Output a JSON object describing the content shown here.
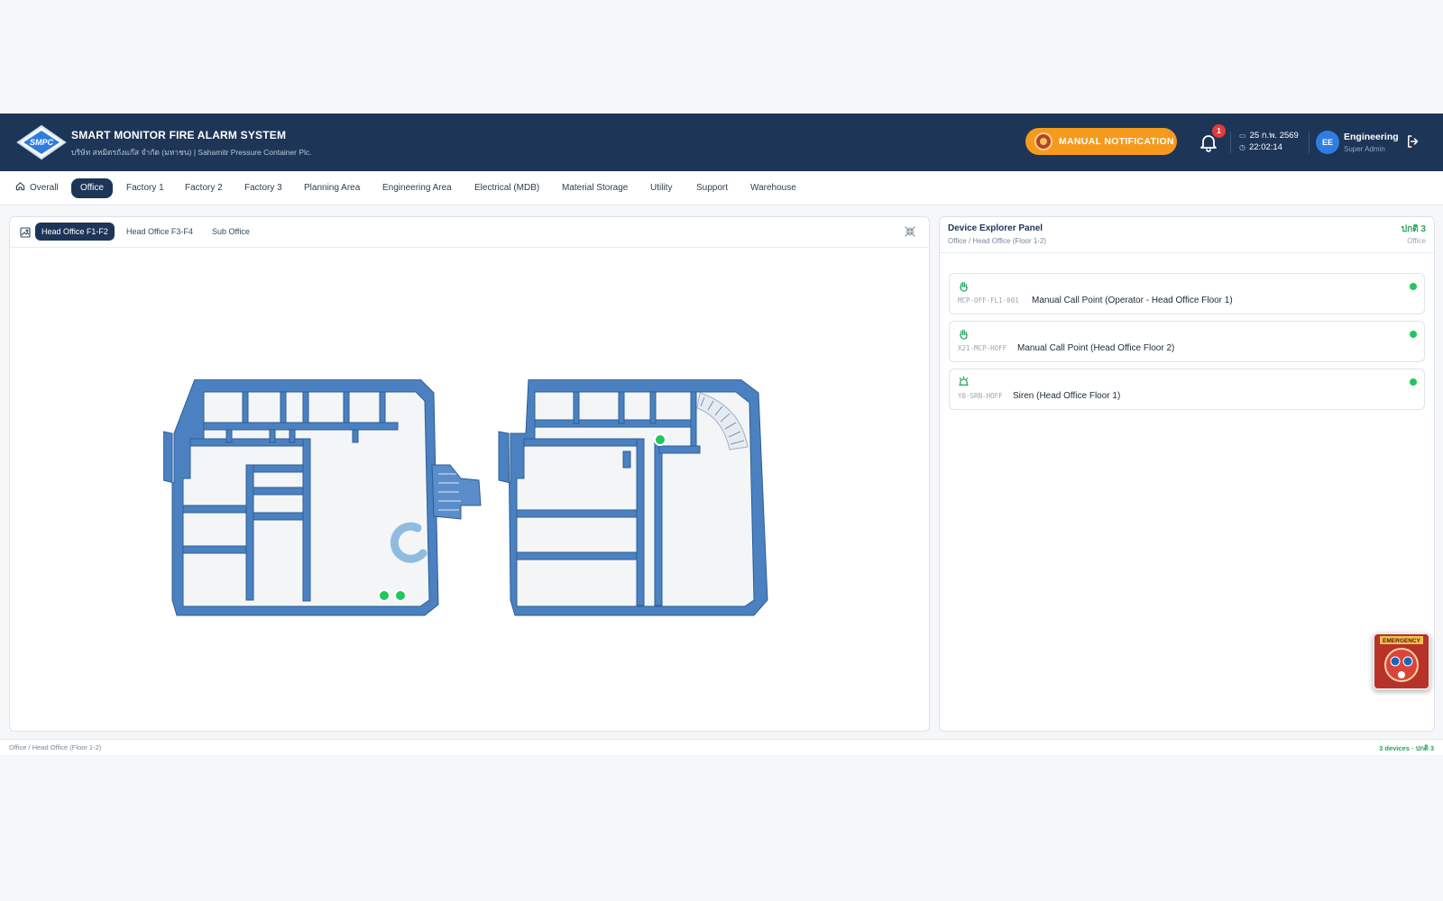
{
  "header": {
    "title": "SMART MONITOR FIRE ALARM SYSTEM",
    "subtitle": "บริษัท สหมิตรถังแก๊ส จำกัด (มหาชน) | Sahamitr Pressure Container Plc.",
    "logo_text": "SMPC",
    "manual_button": "MANUAL NOTIFICATION",
    "notification_count": "1",
    "date": "25 ก.พ. 2569",
    "time": "22:02:14",
    "avatar_initials": "EE",
    "user_name": "Engineering",
    "user_role": "Super Admin",
    "colors": {
      "header_bg": "#1d3557",
      "accent_orange": "#f59a1d",
      "status_green": "#22c55e",
      "badge_red": "#e23b3b"
    }
  },
  "nav": {
    "items": [
      {
        "label": "Overall"
      },
      {
        "label": "Office"
      },
      {
        "label": "Factory 1"
      },
      {
        "label": "Factory 2"
      },
      {
        "label": "Factory 3"
      },
      {
        "label": "Planning Area"
      },
      {
        "label": "Engineering Area"
      },
      {
        "label": "Electrical (MDB)"
      },
      {
        "label": "Material Storage"
      },
      {
        "label": "Utility"
      },
      {
        "label": "Support"
      },
      {
        "label": "Warehouse"
      }
    ],
    "active": "Office"
  },
  "map": {
    "tabs": [
      {
        "label": "Head Office F1-F2"
      },
      {
        "label": "Head Office F3-F4"
      },
      {
        "label": "Sub Office"
      }
    ],
    "active_tab": "Head Office F1-F2"
  },
  "device_panel": {
    "title": "Device Explorer Panel",
    "breadcrumb": "Office / Head Office (Floor 1-2)",
    "status": "ปกติ 3",
    "status_sub": "Office",
    "devices": [
      {
        "code": "MCP-OFF-FL1-001",
        "name": "Manual Call Point (Operator - Head Office Floor 1)",
        "icon": "hand-icon",
        "status": "normal"
      },
      {
        "code": "X21-MCP-HOFF",
        "name": "Manual Call Point (Head Office Floor 2)",
        "icon": "hand-icon",
        "status": "normal"
      },
      {
        "code": "Y0-SRN-HOFF",
        "name": "Siren (Head Office Floor 1)",
        "icon": "siren-icon",
        "status": "normal"
      }
    ],
    "emergency_label": "EMERGENCY"
  },
  "footer": {
    "breadcrumb": "Office / Head Office (Floor 1-2)",
    "summary": "3 devices · ปกติ 3"
  }
}
